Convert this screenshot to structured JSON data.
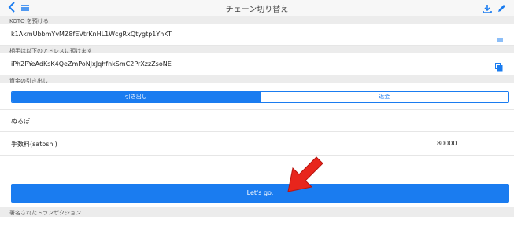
{
  "header": {
    "title": "チェーン切り替え",
    "back_icon": "chevron-left-icon",
    "menu_icon": "menu-icon",
    "download_icon": "download-icon",
    "edit_icon": "pencil-icon"
  },
  "send_section": {
    "label": "KOTO を預ける",
    "value": "k1AkmUbbmYvMZ8fEVtrKnHL1WcgRxQtygtp1YhKT"
  },
  "receive_section": {
    "label": "相手は以下のアドレスに預けます",
    "value": "iPh2PYeAdKsK4QeZmPoNJxJqhfnkSmC2PrXzzZsoNE"
  },
  "withdraw_section": {
    "label": "資金の引き出し",
    "tabs": [
      {
        "label": "引き出し",
        "active": true
      },
      {
        "label": "返金",
        "active": false
      }
    ]
  },
  "amount_row": {
    "value": "ぬるぽ"
  },
  "fee_row": {
    "label": "手数料(satoshi)",
    "value": "80000"
  },
  "go_button": {
    "label": "Let's go."
  },
  "footer_section": {
    "label": "署名されたトランザクション"
  },
  "colors": {
    "accent": "#1a7cf0",
    "arrow": "#e8251c"
  }
}
